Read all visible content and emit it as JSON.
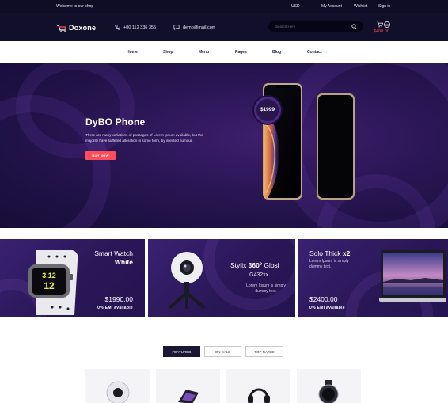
{
  "topbar": {
    "welcome": "Welcome to our shop",
    "currency": "USD",
    "my_account": "My Account",
    "wishlist": "Wishlist",
    "sign_in": "Sign in"
  },
  "header": {
    "logo_text": "Doxone",
    "phone": "+00 112 336 355",
    "email": "demo@mail.com",
    "search_placeholder": "Search Here",
    "cart_count": "03",
    "cart_total": "$400.00"
  },
  "nav": {
    "items": [
      "Home",
      "Shop",
      "Menu",
      "Pages",
      "Blog",
      "Contact"
    ]
  },
  "hero": {
    "title": "DyBO Phone",
    "description": "There are many variations of passages of Lorem Ipsum available, but the majority have suffered alteration in some form, by injected humour.",
    "button": "BUY NOW",
    "price_badge": "$1999"
  },
  "banners": [
    {
      "line1": "Smart Watch",
      "line2": "White",
      "price": "$1990.00",
      "emi": "0% EMI available"
    },
    {
      "line1_a": "Stylix ",
      "line1_b": "360º",
      "line1_c": " Glosi",
      "model": "G432xx",
      "desc": "Lorem Ipsum is simply dummy text."
    },
    {
      "line1_a": "Solo Thick ",
      "line1_b": "x2",
      "desc": "Lorem Ipsum is simply dummy text.",
      "price": "$2400.00",
      "emi": "0% EMI available"
    }
  ],
  "tabs": [
    "FEATURED",
    "ON SALE",
    "TOP RATED"
  ],
  "colors": {
    "accent": "#ff4d5a",
    "dark": "#120f2b",
    "hero_purple": "#2b1656"
  }
}
